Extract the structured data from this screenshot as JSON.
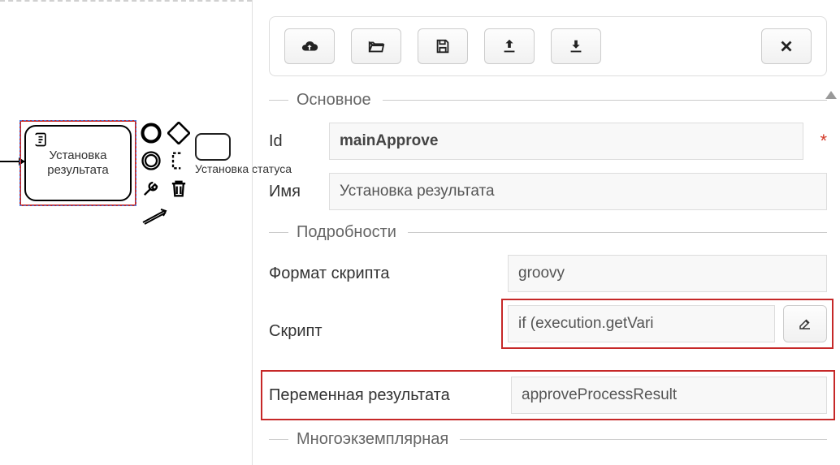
{
  "canvas": {
    "task1_text": "Установка результата",
    "task2_text": "Установка статуса"
  },
  "sections": {
    "main_title": "Основное",
    "details_title": "Подробности",
    "multi_title": "Многоэкземплярная"
  },
  "labels": {
    "id": "Id",
    "name": "Имя",
    "script_format": "Формат скрипта",
    "script": "Скрипт",
    "result_var": "Переменная результата"
  },
  "values": {
    "id": "mainApprove",
    "name": "Установка результата",
    "script_format": "groovy",
    "script": "if (execution.getVari",
    "result_var": "approveProcessResult"
  },
  "icons": {
    "upload_cloud": "cloud-upload",
    "open_folder": "folder-open",
    "save_disk": "save",
    "upload": "upload",
    "download": "download",
    "close": "close",
    "edit": "pencil-square"
  }
}
